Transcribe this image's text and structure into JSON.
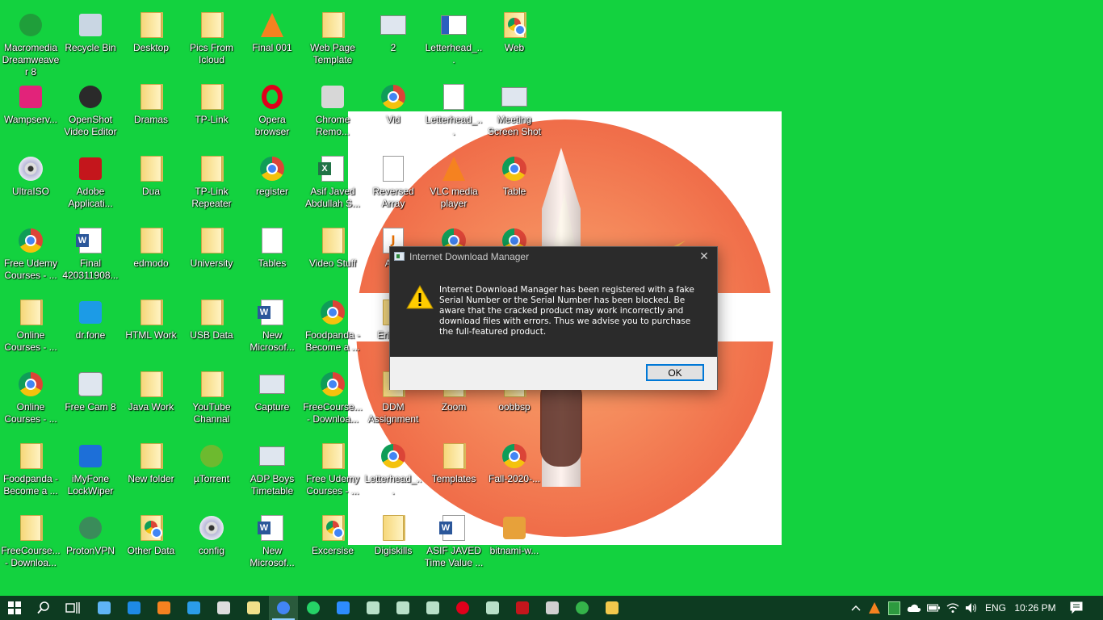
{
  "desktop": {
    "background_color": "#13d23f",
    "icons": [
      {
        "label": "Macromedia Dreamweaver 8",
        "icon": "dreamweaver-icon"
      },
      {
        "label": "Recycle Bin",
        "icon": "recycle-bin-icon"
      },
      {
        "label": "Desktop",
        "icon": "folder-icon"
      },
      {
        "label": "Pics From Icloud",
        "icon": "folder-icon"
      },
      {
        "label": "Final 001",
        "icon": "vlc-icon"
      },
      {
        "label": "Web Page Template",
        "icon": "folder-icon"
      },
      {
        "label": "2",
        "icon": "image-thumbnail-icon"
      },
      {
        "label": "Letterhead_...",
        "icon": "document-thumbnail-icon"
      },
      {
        "label": "Web",
        "icon": "chrome-folder-icon"
      },
      {
        "label": "Wampserv...",
        "icon": "wampserver-icon"
      },
      {
        "label": "OpenShot Video Editor",
        "icon": "openshot-icon"
      },
      {
        "label": "Dramas",
        "icon": "folder-icon"
      },
      {
        "label": "TP-Link",
        "icon": "folder-icon"
      },
      {
        "label": "Opera browser",
        "icon": "opera-icon"
      },
      {
        "label": "Chrome Remo...",
        "icon": "chrome-remote-icon"
      },
      {
        "label": "Vid",
        "icon": "chrome-icon"
      },
      {
        "label": "Letterhead_...",
        "icon": "document-icon"
      },
      {
        "label": "Meeting Screen Shot",
        "icon": "image-thumbnail-icon"
      },
      {
        "label": "UltraISO",
        "icon": "disc-icon"
      },
      {
        "label": "Adobe Applicati...",
        "icon": "adobe-icon"
      },
      {
        "label": "Dua",
        "icon": "folder-icon"
      },
      {
        "label": "TP-Link Repeater",
        "icon": "folder-icon"
      },
      {
        "label": "register",
        "icon": "chrome-icon"
      },
      {
        "label": "Asif Javed Abdullah S...",
        "icon": "excel-icon"
      },
      {
        "label": "Reversed Array",
        "icon": "text-file-icon"
      },
      {
        "label": "VLC media player",
        "icon": "vlc-icon"
      },
      {
        "label": "Table",
        "icon": "chrome-icon"
      },
      {
        "label": "Free Udemy Courses - ...",
        "icon": "chrome-icon"
      },
      {
        "label": "Final 420311908...",
        "icon": "word-icon"
      },
      {
        "label": "edmodo",
        "icon": "folder-icon"
      },
      {
        "label": "University",
        "icon": "folder-icon"
      },
      {
        "label": "Tables",
        "icon": "text-file-icon"
      },
      {
        "label": "Video Stuff",
        "icon": "folder-icon"
      },
      {
        "label": "Abc",
        "icon": "java-icon"
      },
      {
        "label": "",
        "icon": "chrome-icon"
      },
      {
        "label": "",
        "icon": "chrome-icon"
      },
      {
        "label": "Online Courses - ...",
        "icon": "folder-icon"
      },
      {
        "label": "dr.fone",
        "icon": "drfone-icon"
      },
      {
        "label": "HTML Work",
        "icon": "folder-icon"
      },
      {
        "label": "USB Data",
        "icon": "folder-icon"
      },
      {
        "label": "New Microsof...",
        "icon": "word-icon"
      },
      {
        "label": "Foodpanda - Become a ...",
        "icon": "chrome-icon"
      },
      {
        "label": "Eri Sea",
        "icon": "folder-icon"
      },
      {
        "label": "Online Courses - ...",
        "icon": "chrome-icon"
      },
      {
        "label": "Free Cam 8",
        "icon": "freecam-icon"
      },
      {
        "label": "Java Work",
        "icon": "folder-icon"
      },
      {
        "label": "YouTube Channal",
        "icon": "folder-icon"
      },
      {
        "label": "Capture",
        "icon": "image-thumbnail-icon"
      },
      {
        "label": "FreeCourse... - Downloa...",
        "icon": "chrome-icon"
      },
      {
        "label": "DDM Assignment",
        "icon": "folder-icon"
      },
      {
        "label": "Zoom",
        "icon": "folder-icon"
      },
      {
        "label": "oobbsp",
        "icon": "folder-icon"
      },
      {
        "label": "Foodpanda - Become a ...",
        "icon": "folder-icon"
      },
      {
        "label": "iMyFone LockWiper",
        "icon": "imyfone-icon"
      },
      {
        "label": "New folder",
        "icon": "folder-icon"
      },
      {
        "label": "µTorrent",
        "icon": "utorrent-icon"
      },
      {
        "label": "ADP Boys Timetable",
        "icon": "image-thumbnail-icon"
      },
      {
        "label": "Free Udemy Courses - ...",
        "icon": "folder-icon"
      },
      {
        "label": "Letterhead_...",
        "icon": "chrome-icon"
      },
      {
        "label": "Templates",
        "icon": "folder-icon"
      },
      {
        "label": "Fall-2020-...",
        "icon": "chrome-icon"
      },
      {
        "label": "FreeCourse... - Downloa...",
        "icon": "folder-icon"
      },
      {
        "label": "ProtonVPN",
        "icon": "protonvpn-icon"
      },
      {
        "label": "Other Data",
        "icon": "chrome-folder-icon"
      },
      {
        "label": "config",
        "icon": "disc-icon"
      },
      {
        "label": "New Microsof...",
        "icon": "word-icon"
      },
      {
        "label": "Excersise",
        "icon": "chrome-folder-icon"
      },
      {
        "label": "Digiskills",
        "icon": "word-folder-icon"
      },
      {
        "label": "ASIF JAVED Time Value ...",
        "icon": "word-icon"
      },
      {
        "label": "bitnami-w...",
        "icon": "bitnami-icon"
      }
    ]
  },
  "dialog": {
    "title": "Internet Download Manager",
    "close_glyph": "✕",
    "message": "Internet Download Manager has been registered with a fake Serial Number or the Serial Number has been blocked. Be aware that the cracked product may work incorrectly and download files with errors. Thus we advise you to purchase the full-featured product.",
    "ok_label": "OK",
    "warning_color": "#ffcc00"
  },
  "taskbar": {
    "color": "#0d3b21",
    "apps": [
      "start-icon",
      "search-icon",
      "task-view-icon",
      "this-pc-icon",
      "edge-icon",
      "vlc-icon",
      "vscode-icon",
      "file-icon",
      "notepad-icon",
      "chrome-icon",
      "whatsapp-icon",
      "zoom-icon",
      "app-icon",
      "app-icon",
      "app-icon",
      "opera-icon",
      "app-icon",
      "adobe-icon",
      "printer-icon",
      "dreamweaver-icon",
      "file-explorer-icon"
    ],
    "tray": {
      "language": "ENG",
      "time": "10:26 PM"
    }
  }
}
